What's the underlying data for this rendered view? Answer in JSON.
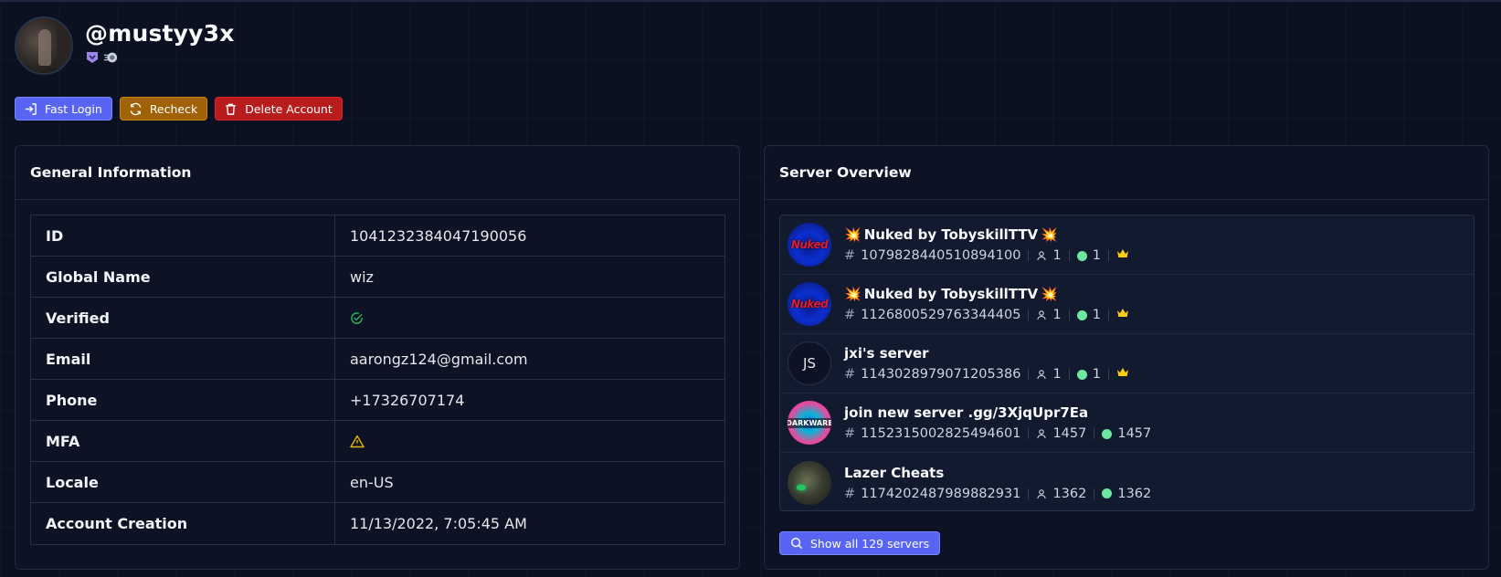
{
  "profile": {
    "username": "@mustyy3x",
    "badges": [
      "hypesquad-badge-icon",
      "nitro-badge-icon"
    ]
  },
  "actions": {
    "fast_login": "Fast Login",
    "recheck": "Recheck",
    "delete": "Delete Account"
  },
  "colors": {
    "accent": "#5865f2",
    "recheck": "#a16207",
    "danger": "#b91c1c",
    "online": "#6ee7a0",
    "crown": "#facc15",
    "verified": "#22c55e",
    "warning": "#eab308"
  },
  "general": {
    "title": "General Information",
    "rows": [
      {
        "key": "ID",
        "value": "1041232384047190056"
      },
      {
        "key": "Global Name",
        "value": "wiz"
      },
      {
        "key": "Verified",
        "value": "",
        "icon": "check-circle-icon"
      },
      {
        "key": "Email",
        "value": "aarongz124@gmail.com"
      },
      {
        "key": "Phone",
        "value": "+17326707174"
      },
      {
        "key": "MFA",
        "value": "",
        "icon": "warning-triangle-icon"
      },
      {
        "key": "Locale",
        "value": "en-US"
      },
      {
        "key": "Account Creation",
        "value": "11/13/2022, 7:05:45 AM"
      }
    ]
  },
  "servers": {
    "title": "Server Overview",
    "items": [
      {
        "name": "Nuked by TobyskillTTV",
        "icon_text": "Nuked",
        "id": "1079828440510894100",
        "members": "1",
        "online": "1",
        "owner": true,
        "emoji": "💥"
      },
      {
        "name": "Nuked by TobyskillTTV",
        "icon_text": "Nuked",
        "id": "1126800529763344405",
        "members": "1",
        "online": "1",
        "owner": true,
        "emoji": "💥"
      },
      {
        "name": "jxi's server",
        "icon_text": "JS",
        "id": "1143028979071205386",
        "members": "1",
        "online": "1",
        "owner": true
      },
      {
        "name": "join new server .gg/3XjqUpr7Ea",
        "icon_text": "DARKWARE",
        "id": "1152315002825494601",
        "members": "1457",
        "online": "1457",
        "owner": false
      },
      {
        "name": "Lazer Cheats",
        "icon_text": "",
        "id": "1174202487989882931",
        "members": "1362",
        "online": "1362",
        "owner": false
      }
    ],
    "show_all": "Show all 129 servers"
  }
}
